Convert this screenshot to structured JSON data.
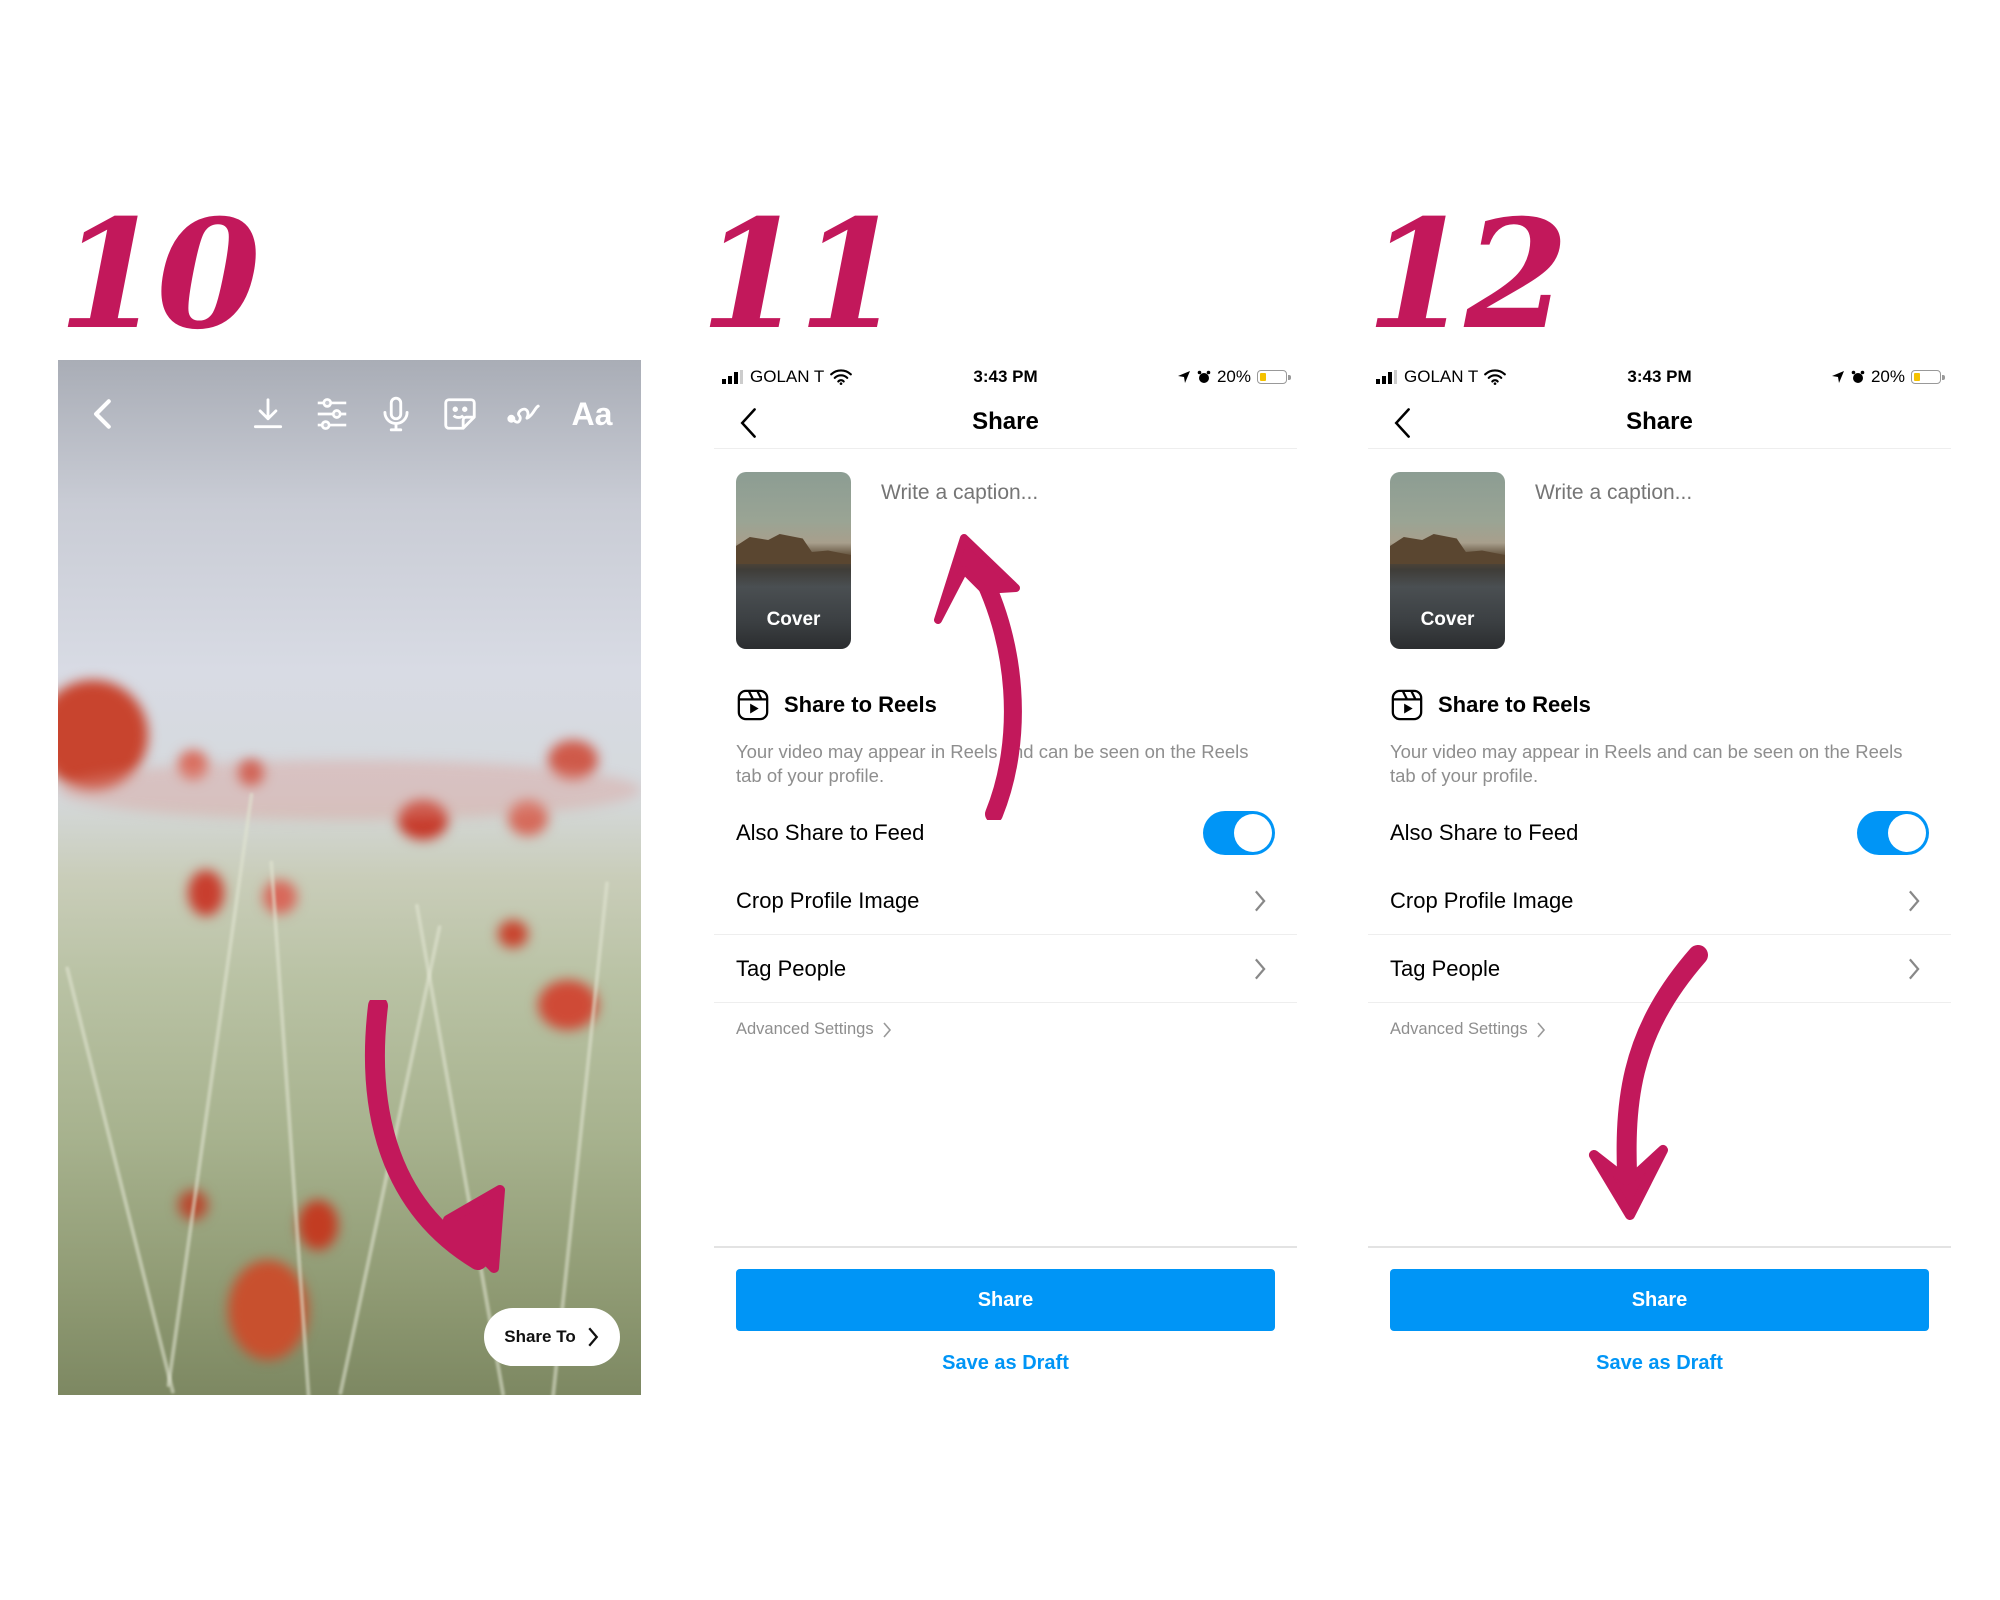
{
  "steps": [
    "10",
    "11",
    "12"
  ],
  "colors": {
    "accent": "#C2185B",
    "instagram_blue": "#0095f6",
    "secondary_text": "#8e8e8e"
  },
  "story_editor": {
    "toolbar": [
      {
        "icon": "back-chevron-icon"
      },
      {
        "icon": "download-icon"
      },
      {
        "icon": "sliders-icon"
      },
      {
        "icon": "microphone-icon"
      },
      {
        "icon": "sticker-icon"
      },
      {
        "icon": "draw-squiggle-icon"
      },
      {
        "icon": "text-icon",
        "label": "Aa"
      }
    ],
    "share_to_label": "Share To"
  },
  "share_screen": {
    "status": {
      "carrier": "GOLAN T",
      "time": "3:43 PM",
      "battery": "20%",
      "battery_level": 0.2
    },
    "title": "Share",
    "cover_label": "Cover",
    "caption_placeholder": "Write a caption...",
    "reels_title": "Share to Reels",
    "reels_description": "Your video may appear in Reels and can be seen on the Reels tab of your profile.",
    "also_share_feed": "Also Share to Feed",
    "also_share_feed_on": true,
    "crop_profile": "Crop Profile Image",
    "tag_people": "Tag People",
    "advanced_settings": "Advanced Settings",
    "share_button": "Share",
    "save_draft": "Save as Draft"
  }
}
